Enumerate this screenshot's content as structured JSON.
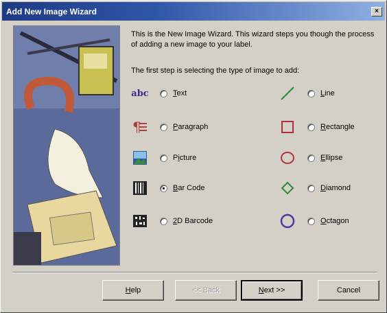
{
  "window": {
    "title": "Add New Image Wizard",
    "close_glyph": "×"
  },
  "intro_text": "This is the New Image Wizard. This wizard steps you though the process of adding a new image to your label.",
  "step_text": "The first step is selecting the type of image to add:",
  "icon_text": "abc",
  "options_left": [
    {
      "name": "text",
      "pre": "",
      "accel": "T",
      "post": "ext",
      "icon": "text-abc-icon",
      "checked": false
    },
    {
      "name": "paragraph",
      "pre": "",
      "accel": "P",
      "post": "aragraph",
      "icon": "paragraph-icon",
      "checked": false
    },
    {
      "name": "picture",
      "pre": "P",
      "accel": "i",
      "post": "cture",
      "icon": "picture-icon",
      "checked": false
    },
    {
      "name": "bar-code",
      "pre": "",
      "accel": "B",
      "post": "ar Code",
      "icon": "barcode-icon",
      "checked": true
    },
    {
      "name": "2d-barcode",
      "pre": "",
      "accel": "2",
      "post": "D Barcode",
      "icon": "2d-barcode-icon",
      "checked": false
    }
  ],
  "options_right": [
    {
      "name": "line",
      "pre": "",
      "accel": "L",
      "post": "ine",
      "icon": "line-icon",
      "checked": false
    },
    {
      "name": "rectangle",
      "pre": "",
      "accel": "R",
      "post": "ectangle",
      "icon": "rectangle-icon",
      "checked": false
    },
    {
      "name": "ellipse",
      "pre": "",
      "accel": "E",
      "post": "llipse",
      "icon": "ellipse-icon",
      "checked": false
    },
    {
      "name": "diamond",
      "pre": "",
      "accel": "D",
      "post": "iamond",
      "icon": "diamond-icon",
      "checked": false
    },
    {
      "name": "octagon",
      "pre": "",
      "accel": "O",
      "post": "ctagon",
      "icon": "octagon-icon",
      "checked": false
    }
  ],
  "buttons": {
    "help": {
      "accel": "H",
      "post": "elp"
    },
    "back": {
      "label": "<< Back"
    },
    "next": {
      "accel": "N",
      "post": "ext >>"
    },
    "cancel": {
      "label": "Cancel"
    }
  },
  "colors": {
    "title_gradient_start": "#1e3a84",
    "shape_red": "#b03040",
    "shape_green": "#2a8a3a",
    "shape_purple": "#4a3aa0"
  }
}
